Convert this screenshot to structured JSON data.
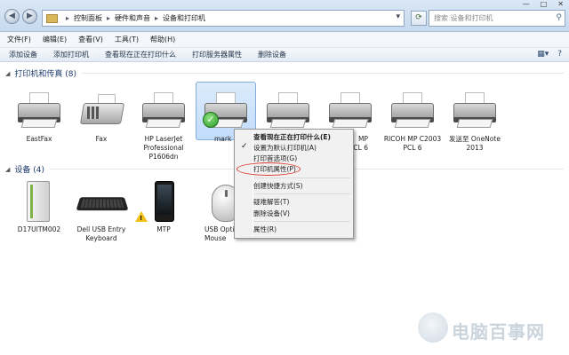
{
  "window": {
    "min": "—",
    "max": "□",
    "close": "✕"
  },
  "address": {
    "crumbs": [
      "控制面板",
      "硬件和声音",
      "设备和打印机"
    ],
    "search_placeholder": "搜索 设备和打印机"
  },
  "menubar": [
    "文件(F)",
    "编辑(E)",
    "查看(V)",
    "工具(T)",
    "帮助(H)"
  ],
  "commands": [
    "添加设备",
    "添加打印机",
    "查看现在正在打印什么",
    "打印服务器属性",
    "删除设备"
  ],
  "groups": {
    "printers": {
      "title": "打印机和传真 (8)",
      "items": [
        {
          "label": "EastFax",
          "icon": "printer-icon"
        },
        {
          "label": "Fax",
          "icon": "fax-icon"
        },
        {
          "label": "HP LaserJet Professional P1606dn",
          "icon": "printer-icon"
        },
        {
          "label": "mark",
          "icon": "printer-icon",
          "default": true
        },
        {
          "label": "MP",
          "icon": "printer-icon"
        },
        {
          "label": "MP\nCL 6",
          "icon": "printer-icon"
        },
        {
          "label": "RICOH MP C2003 PCL 6",
          "icon": "printer-icon"
        },
        {
          "label": "发送至 OneNote 2013",
          "icon": "printer-icon"
        }
      ]
    },
    "devices": {
      "title": "设备 (4)",
      "items": [
        {
          "label": "D17UITM002",
          "icon": "hard-drive-icon"
        },
        {
          "label": "Dell USB Entry Keyboard",
          "icon": "keyboard-icon"
        },
        {
          "label": "MTP",
          "icon": "phone-icon",
          "warning": true
        },
        {
          "label": "USB Opti\nMouse",
          "icon": "mouse-icon"
        }
      ]
    }
  },
  "context_menu": {
    "items": [
      {
        "label": "查看现在正在打印什么(E)",
        "bold": true
      },
      {
        "label": "设置为默认打印机(A)",
        "checked": true
      },
      {
        "label": "打印首选项(G)"
      },
      {
        "label": "打印机属性(P)",
        "highlighted": true
      },
      {
        "label": "创建快捷方式(S)"
      },
      {
        "label": "疑难解答(T)"
      },
      {
        "label": "删除设备(V)"
      },
      {
        "label": "属性(R)"
      }
    ],
    "check_glyph": "✓"
  },
  "watermark": "电脑百事网",
  "colors": {
    "accent": "#1e3a6e",
    "highlight_oval": "#d9392b",
    "selection": "#c1dcfc"
  }
}
